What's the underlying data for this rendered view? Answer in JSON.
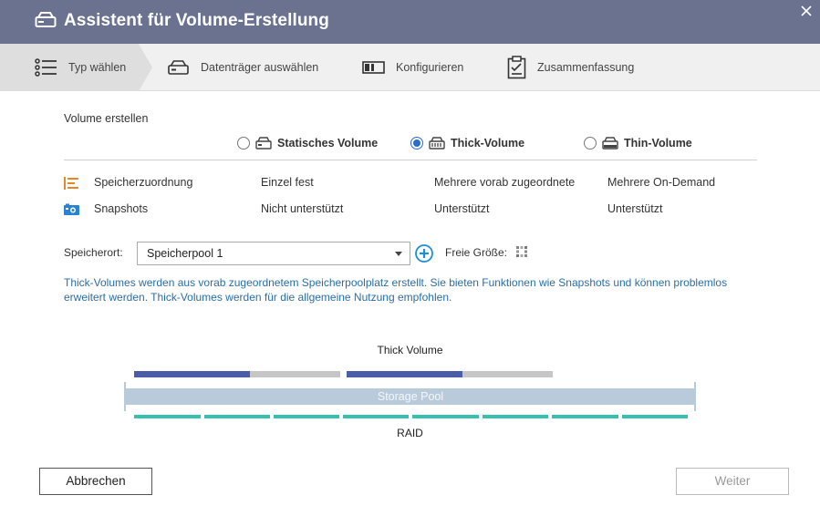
{
  "window": {
    "title": "Assistent für Volume-Erstellung",
    "icon": "drive-icon",
    "close_icon": "close-icon"
  },
  "steps": [
    {
      "label": "Typ wählen",
      "icon": "list-icon",
      "active": true
    },
    {
      "label": "Datenträger auswählen",
      "icon": "disk-icon",
      "active": false
    },
    {
      "label": "Konfigurieren",
      "icon": "configure-icon",
      "active": false
    },
    {
      "label": "Zusammenfassung",
      "icon": "clipboard-icon",
      "active": false
    }
  ],
  "section_title": "Volume erstellen",
  "volume_types": [
    {
      "label": "Statisches Volume",
      "selected": false,
      "icon": "static-volume-icon"
    },
    {
      "label": "Thick-Volume",
      "selected": true,
      "icon": "thick-volume-icon"
    },
    {
      "label": "Thin-Volume",
      "selected": false,
      "icon": "thin-volume-icon"
    }
  ],
  "features": [
    {
      "label": "Speicherzuordnung",
      "icon": "allocation-icon",
      "static": "Einzel fest",
      "thick": "Mehrere vorab zugeordnete",
      "thin": "Mehrere On-Demand"
    },
    {
      "label": "Snapshots",
      "icon": "snapshot-icon",
      "static": "Nicht unterstützt",
      "thick": "Unterstützt",
      "thin": "Unterstützt"
    }
  ],
  "location": {
    "label": "Speicherort:",
    "value": "Speicherpool 1",
    "free_size_label": "Freie Größe:"
  },
  "description": "Thick-Volumes werden aus vorab zugeordnetem Speicherpoolplatz erstellt. Sie bieten Funktionen wie Snapshots und können problemlos erweitert werden. Thick-Volumes werden für die allgemeine Nutzung empfohlen.",
  "diagram": {
    "title": "Thick Volume",
    "pool_label": "Storage Pool",
    "raid_label": "RAID",
    "volume_fill": [
      0.56,
      0.56
    ],
    "colors": {
      "used": "#4a5ea8",
      "free": "#c6c6c6",
      "pool": "#b9cbdb",
      "raid": "#36c0b0"
    }
  },
  "buttons": {
    "cancel": "Abbrechen",
    "next": "Weiter"
  },
  "colors": {
    "titlebar": "#6b7290",
    "accent": "#2a6ec9",
    "info_text": "#2a6ea8"
  }
}
